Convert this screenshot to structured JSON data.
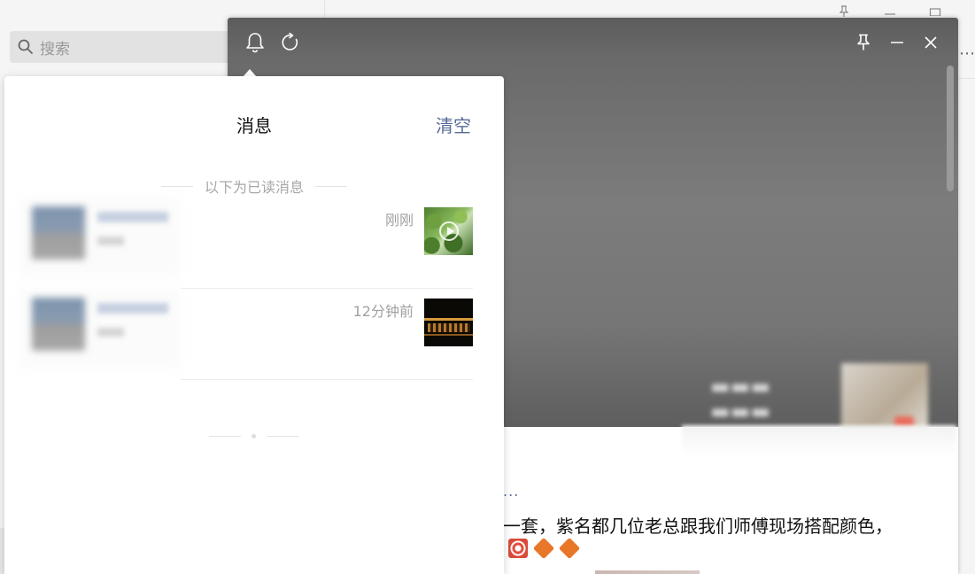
{
  "main_window": {
    "search_placeholder": "搜索"
  },
  "moments_window": {
    "ellipsis": "...",
    "post_text": "一套，紫名都几位老总跟我们师傅现场搭配颜色，",
    "emojis": [
      "firecracker",
      "fu-sticker",
      "fu-sticker"
    ],
    "icons": {
      "bell": "bell-icon",
      "refresh": "refresh-icon",
      "pin": "pin-icon",
      "minimize": "minimize-icon",
      "close": "close-icon"
    }
  },
  "notifications": {
    "title": "消息",
    "clear_label": "清空",
    "read_divider": "以下为已读消息",
    "items": [
      {
        "time": "刚刚",
        "thumb": "forest-video"
      },
      {
        "time": "12分钟前",
        "thumb": "night-building"
      }
    ]
  }
}
